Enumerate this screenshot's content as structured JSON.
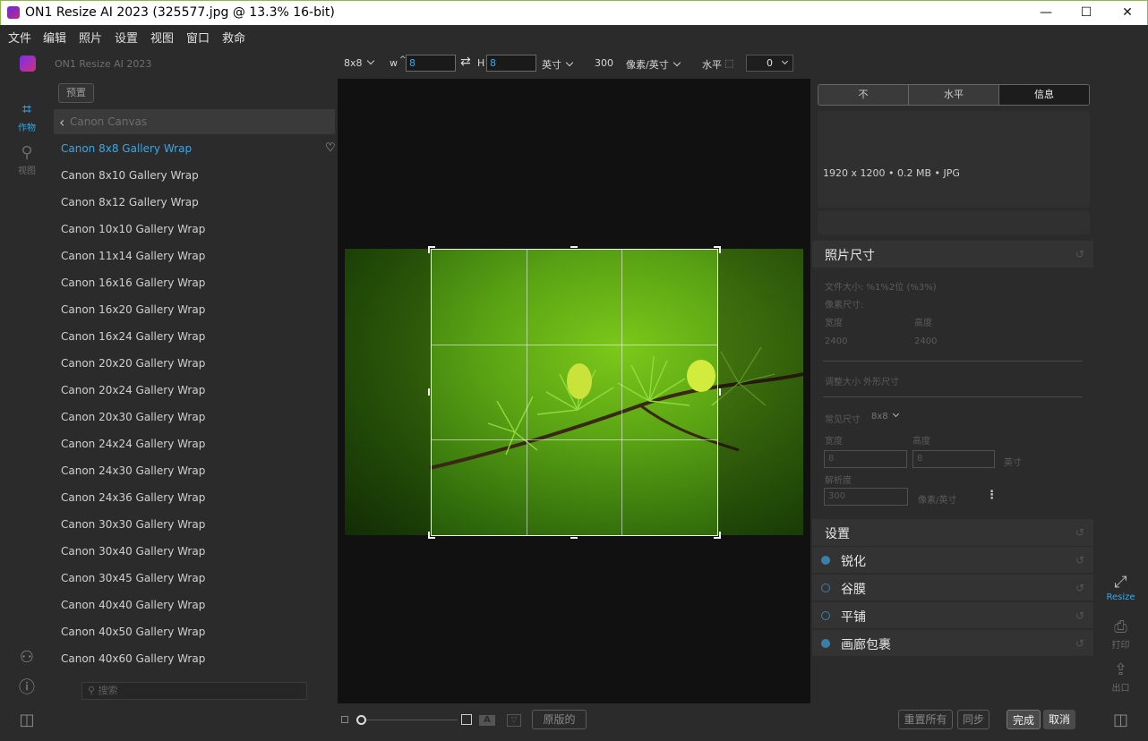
{
  "window": {
    "title": "ON1 Resize AI 2023 (325577.jpg @ 13.3% 16-bit)",
    "minimize": "—",
    "maximize": "☐",
    "close": "✕"
  },
  "menu": [
    "文件",
    "编辑",
    "照片",
    "设置",
    "视图",
    "窗口",
    "救命"
  ],
  "toolbar": {
    "app_name": "ON1 Resize AI 2023",
    "preset_size": "8x8",
    "w_label": "w",
    "w_value": "8",
    "swap_icon": "⇄",
    "h_label": "H",
    "h_value": "8",
    "unit": "英寸",
    "resolution": "300",
    "res_unit": "像素/英寸",
    "orientation": "水平",
    "rotation": "0"
  },
  "rail": {
    "crop_label": "作物",
    "view_label": "视图"
  },
  "presets": {
    "button": "预置",
    "category": "Canon Canvas",
    "items": [
      "Canon 8x8 Gallery Wrap",
      "Canon 8x10 Gallery Wrap",
      "Canon 8x12 Gallery Wrap",
      "Canon 10x10 Gallery Wrap",
      "Canon 11x14 Gallery Wrap",
      "Canon 16x16 Gallery Wrap",
      "Canon 16x20 Gallery Wrap",
      "Canon 16x24 Gallery Wrap",
      "Canon 20x20 Gallery Wrap",
      "Canon 20x24 Gallery Wrap",
      "Canon 20x30 Gallery Wrap",
      "Canon 24x24 Gallery Wrap",
      "Canon 24x30 Gallery Wrap",
      "Canon 24x36 Gallery Wrap",
      "Canon 30x30 Gallery Wrap",
      "Canon 30x40 Gallery Wrap",
      "Canon 30x45 Gallery Wrap",
      "Canon 40x40 Gallery Wrap",
      "Canon 40x50 Gallery Wrap",
      "Canon 40x60 Gallery Wrap"
    ],
    "active_index": 0,
    "search_placeholder": "搜索"
  },
  "bottom": {
    "original": "原版的",
    "reset_all": "重置所有",
    "sync": "同步",
    "done": "完成",
    "cancel": "取消"
  },
  "right": {
    "tabs": [
      "不",
      "水平",
      "信息"
    ],
    "active_tab": 2,
    "info": "1920 x 1200 • 0.2 MB • JPG",
    "photo_size": {
      "title": "照片尺寸",
      "file_size": "文件大小: %1%2位 (%3%)",
      "pixel_dims": "像素尺寸:",
      "width_label": "宽度",
      "height_label": "高度",
      "px_width": "2400",
      "px_height": "2400",
      "resize_label": "调整大小  外形尺寸",
      "common_size_label": "常见尺寸",
      "common_size_value": "8x8",
      "doc_width_label": "宽度",
      "doc_height_label": "高度",
      "doc_width": "8",
      "doc_height": "8",
      "doc_unit": "英寸",
      "resolution_label": "解析度",
      "resolution": "300",
      "resolution_unit": "像素/英寸"
    },
    "settings": {
      "title": "设置",
      "rows": [
        "锐化",
        "谷膜",
        "平铺",
        "画廊包裹"
      ]
    }
  },
  "rrail": {
    "resize": "Resize",
    "print": "打印",
    "export": "出口"
  },
  "colors": {
    "accent": "#3aa7e6",
    "setting_dot": "#3a7fa8"
  }
}
